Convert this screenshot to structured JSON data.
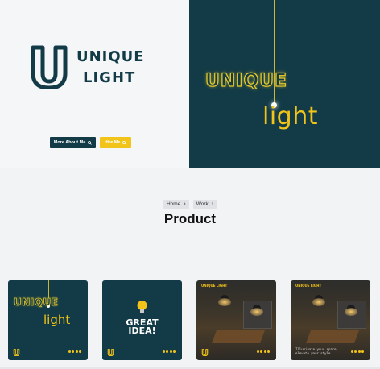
{
  "hero": {
    "logo_word_1": "UNIQUE",
    "logo_word_2": "LIGHT",
    "about_button": "More About Me",
    "hire_button": "Hire Me",
    "neon_word_1": "UNIQUE",
    "neon_word_2": "light"
  },
  "breadcrumb": [
    "Home",
    "Work"
  ],
  "page_title": "Product",
  "cards": [
    {
      "word_1": "UNIQUE",
      "word_2": "light"
    },
    {
      "text_1": "GREAT",
      "text_2": "IDEA!"
    },
    {
      "tag": "UNIQUE LIGHT"
    },
    {
      "tag": "UNIQUE LIGHT",
      "caption_1": "Illuminate your space,",
      "caption_2": "elevate your style."
    }
  ],
  "colors": {
    "brand_dark": "#123b47",
    "brand_yellow": "#f2c318"
  },
  "icons": [
    "search-icon",
    "chevron-right-icon",
    "logo-u-icon",
    "lightbulb-icon"
  ]
}
